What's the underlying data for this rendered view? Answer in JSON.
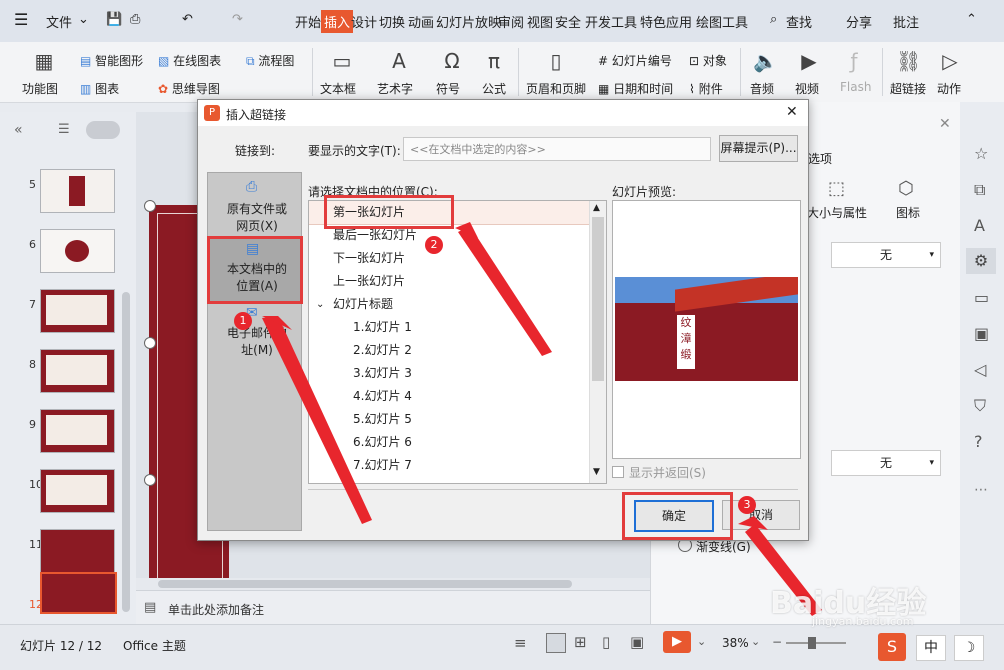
{
  "menubar": {
    "file": "文件",
    "tabs": [
      "开始",
      "插入",
      "设计",
      "切换",
      "动画",
      "幻灯片放映",
      "审阅",
      "视图",
      "安全",
      "开发工具",
      "特色应用",
      "绘图工具"
    ],
    "active_tab": "插入",
    "search": "查找",
    "share": "分享",
    "comment": "批注"
  },
  "ribbon": {
    "smartart": "智能图形",
    "online_chart": "在线图表",
    "flowchart": "流程图",
    "function_chart": "功能图",
    "chart": "图表",
    "mindmap": "思维导图",
    "textbox": "文本框",
    "wordart": "艺术字",
    "symbol": "符号",
    "formula": "公式",
    "header_footer": "页眉和页脚",
    "slide_number": "幻灯片编号",
    "object": "对象",
    "datetime": "日期和时间",
    "attachment": "附件",
    "audio": "音频",
    "video": "视频",
    "flash": "Flash",
    "hyperlink": "超链接",
    "action": "动作"
  },
  "thumbnails": {
    "numbers": [
      "5",
      "6",
      "7",
      "8",
      "9",
      "10",
      "11",
      "12"
    ],
    "active": "12"
  },
  "dialog": {
    "title": "插入超链接",
    "link_to": "链接到:",
    "display_text_label": "要显示的文字(T):",
    "display_text_placeholder": "<<在文档中选定的内容>>",
    "screen_tip": "屏幕提示(P)...",
    "nav": {
      "existing_file": "原有文件或网页(X)",
      "this_document": "本文档中的位置(A)",
      "email": "电子邮件地址(M)"
    },
    "select_place_label": "请选择文档中的位置(C):",
    "preview_label": "幻灯片预览:",
    "list": [
      "第一张幻灯片",
      "最后一张幻灯片",
      "下一张幻灯片",
      "上一张幻灯片",
      "幻灯片标题",
      "1.幻灯片 1",
      "2.幻灯片 2",
      "3.幻灯片 3",
      "4.幻灯片 4",
      "5.幻灯片 5",
      "6.幻灯片 6",
      "7.幻灯片 7"
    ],
    "show_and_return": "显示并返回(S)",
    "ok": "确定",
    "cancel": "取消",
    "preview_text": "纹漳缎"
  },
  "right_panel": {
    "tab_options": "选项",
    "size_props": "大小与属性",
    "icon": "图标",
    "none1": "无",
    "none2": "无",
    "gradient": "渐变线(G)"
  },
  "badges": [
    "1",
    "2",
    "3"
  ],
  "statusbar": {
    "slide": "幻灯片 12 / 12",
    "theme": "Office 主题",
    "notes": "单击此处添加备注",
    "zoom": "38%",
    "ime": "中"
  },
  "watermark": {
    "text": "Baidu经验",
    "url": "jingyan.baidu.com"
  },
  "colors": {
    "accent": "#e8582f",
    "annotation": "#e23c3c",
    "slide_red": "#8b1a23"
  }
}
